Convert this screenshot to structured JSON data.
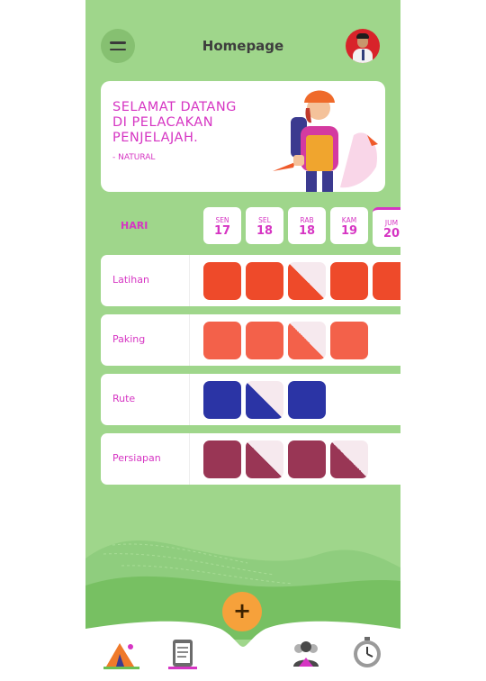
{
  "header": {
    "title": "Homepage",
    "menu_icon": "hamburger-icon",
    "avatar_icon": "profile-photo"
  },
  "welcome": {
    "lines": [
      "SELAMAT DATANG",
      "DI PELACAKAN",
      "PENJELAJAH."
    ],
    "caption": "- NATURAL"
  },
  "schedule": {
    "label": "HARI",
    "days": [
      {
        "name": "SEN",
        "date": "17"
      },
      {
        "name": "SEL",
        "date": "18"
      },
      {
        "name": "RAB",
        "date": "18"
      },
      {
        "name": "KAM",
        "date": "19"
      },
      {
        "name": "JUM",
        "date": "20"
      }
    ],
    "rows": [
      {
        "label": "Latihan",
        "color": "#ee4a2a",
        "cells": [
          "full",
          "full",
          "half",
          "full",
          "full"
        ]
      },
      {
        "label": "Paking",
        "color": "#f3614a",
        "cells": [
          "full",
          "full",
          "half",
          "full"
        ]
      },
      {
        "label": "Rute",
        "color": "#2b34a5",
        "cells": [
          "full",
          "half",
          "full"
        ]
      },
      {
        "label": "Persiapan",
        "color": "#993655",
        "cells": [
          "full",
          "half",
          "full",
          "half"
        ]
      }
    ]
  },
  "nav": {
    "add_label": "+",
    "items": [
      "camp-tent-icon",
      "checklist-clipboard-icon",
      "group-people-icon",
      "stopwatch-icon"
    ]
  },
  "colors": {
    "background": "#9fd68b",
    "accent": "#d635c3",
    "fab": "#f6a13b"
  }
}
